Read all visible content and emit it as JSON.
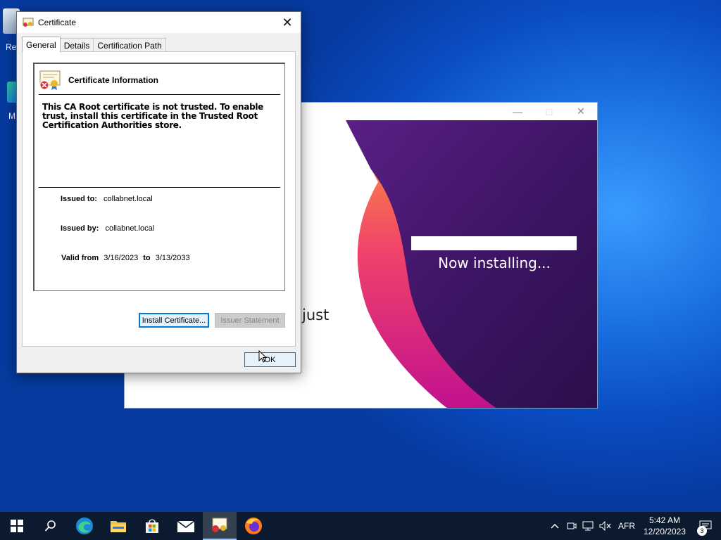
{
  "desktop": {
    "icons": [
      {
        "label": "Re"
      },
      {
        "label": "M"
      }
    ]
  },
  "installer": {
    "status_text": "Now installing...",
    "background_text": "just",
    "progress": 1.0,
    "colors": {
      "purple": "#4a1a7a",
      "pink": "#e8157c",
      "orange": "#ff8a3d"
    }
  },
  "certificate_dialog": {
    "title": "Certificate",
    "tabs": [
      "General",
      "Details",
      "Certification Path"
    ],
    "header": "Certificate Information",
    "warning": "This CA Root certificate is not trusted. To enable trust, install this certificate in the Trusted Root Certification Authorities store.",
    "issued_to_label": "Issued to:",
    "issued_to_value": "collabnet.local",
    "issued_by_label": "Issued by:",
    "issued_by_value": "collabnet.local",
    "valid_from_label": "Valid from",
    "valid_from_value": "3/16/2023",
    "valid_to_label": "to",
    "valid_to_value": "3/13/2033",
    "install_button": "Install Certificate...",
    "issuer_statement_button": "Issuer Statement",
    "ok_button": "OK"
  },
  "taskbar": {
    "apps": [
      "start",
      "search",
      "edge",
      "file-explorer",
      "store",
      "mail",
      "certificate",
      "firefox"
    ],
    "language": "AFR",
    "time": "5:42 AM",
    "date": "12/20/2023",
    "notification_count": "3"
  }
}
